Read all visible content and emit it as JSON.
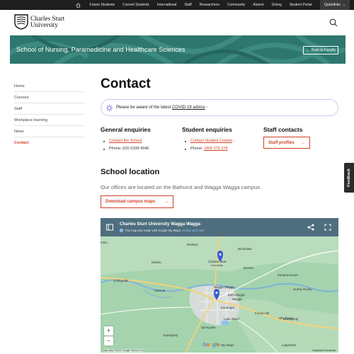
{
  "topbar": {
    "links": [
      "Future Students",
      "Current Students",
      "International",
      "Staff",
      "Researchers",
      "Community",
      "Alumni",
      "Giving",
      "Student Portal"
    ],
    "quicklinks": "Quicklinks"
  },
  "header": {
    "logo_line1": "Charles Sturt",
    "logo_line2": "University"
  },
  "banner": {
    "title": "School of Nursing, Paramedicine and Healthcare Sciences",
    "back": "Back to Faculty"
  },
  "sidenav": {
    "items": [
      "Home",
      "Courses",
      "Staff",
      "Workplace learning",
      "News",
      "Contact"
    ]
  },
  "main": {
    "title": "Contact",
    "alert_prefix": "Please be aware of the latest ",
    "alert_link": "COVID-19 advice",
    "general": {
      "heading": "General enquiries",
      "link": "Contact the School",
      "phone": "Phone: (02) 6338 4546"
    },
    "student": {
      "heading": "Student enquiries",
      "link": "Contact Student Central",
      "phone_label": "Phone: ",
      "phone": "1800 275 278"
    },
    "staff": {
      "heading": "Staff contacts",
      "button": "Staff profiles"
    },
    "location_heading": "School location",
    "location_text": "Our offices are located on the Bathurst and Wagga Wagga campus.",
    "maps_button": "Download campus maps"
  },
  "map": {
    "title": "Charles Sturt University Wagga Wagga",
    "subtitle": "This map was made with Google My Maps.",
    "subtitle_link": "Create your own.",
    "labels": {
      "mme": "mme",
      "dhulura": "Dhulura",
      "brucedale": "Brucedale",
      "eunanoreenya": "Eunanoreenya",
      "eubelo": "Eubelo",
      "csu_line1": "Charles Sturt",
      "csu_line2": "University",
      "bomen": "Bomen",
      "collingullie": "Collingullie",
      "gumly": "Gumly Gumly",
      "euberta": "Euberta",
      "wagga": "Wagga Wagga",
      "east_wagga": "East Wagga",
      "east_wagga2": "Wagga",
      "kooringal": "Kooringal",
      "forest_hill": "Forest Hill",
      "uranquinty_r": "Uranquinty",
      "lake_albert": "Lake Albert",
      "springvale": "Springvale",
      "alfredtown": "Alfredtown",
      "ladysmith": "Ladysmith",
      "uranquinty": "Uranquinty"
    },
    "zoom_in": "+",
    "zoom_out": "−",
    "attribution": "Map data ©2021 Google   Terms   2 km",
    "google": "Google",
    "mymaps": "My Maps",
    "keyboard": "Keyboard shortcuts"
  },
  "feedback": "Feedback",
  "colors": {
    "accent": "#d14124",
    "banner": "#2e776e",
    "map_header": "#4e6e7e"
  }
}
